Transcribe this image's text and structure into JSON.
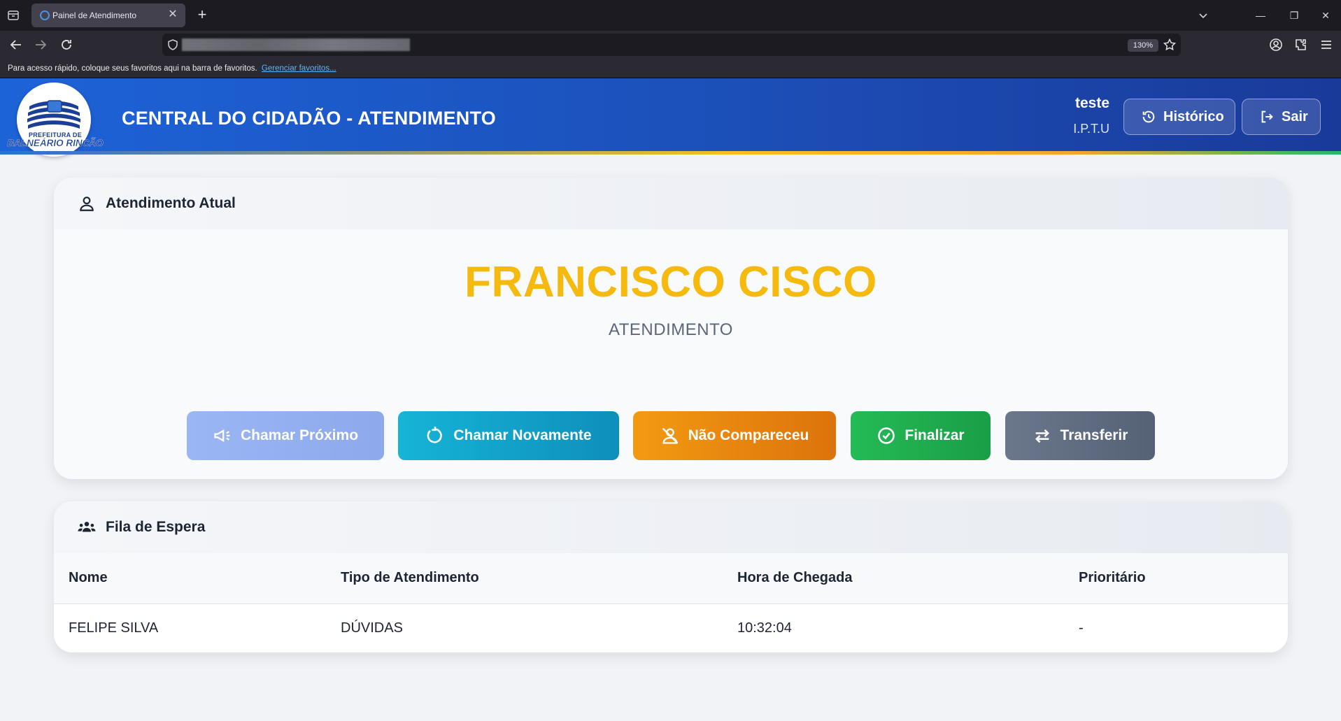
{
  "browser": {
    "tab_title": "Painel de Atendimento",
    "zoom": "130%",
    "bookmarks_text": "Para acesso rápido, coloque seus favoritos aqui na barra de favoritos.",
    "bookmarks_link": "Gerenciar favoritos..."
  },
  "header": {
    "logo_line1": "PREFEITURA DE",
    "logo_line2": "BALNEÁRIO RINCÃO",
    "title": "CENTRAL DO CIDADÃO - ATENDIMENTO",
    "user_name": "teste",
    "user_role": "I.P.T.U",
    "history_label": "Histórico",
    "logout_label": "Sair"
  },
  "current": {
    "title": "Atendimento Atual",
    "name": "FRANCISCO CISCO",
    "service": "ATENDIMENTO",
    "actions": {
      "call_next": "Chamar Próximo",
      "call_again": "Chamar Novamente",
      "no_show": "Não Compareceu",
      "finish": "Finalizar",
      "transfer": "Transferir"
    }
  },
  "queue": {
    "title": "Fila de Espera",
    "columns": [
      "Nome",
      "Tipo de Atendimento",
      "Hora de Chegada",
      "Prioritário"
    ],
    "rows": [
      [
        "FELIPE SILVA",
        "DÚVIDAS",
        "10:32:04",
        "-"
      ]
    ]
  },
  "colors": {
    "header_blue": "#1d63d8",
    "name_yellow": "#f6b90e",
    "call_next": "#97b0f2",
    "call_again": "#13a6c9",
    "no_show": "#ef8a12",
    "finish": "#21b04f",
    "transfer": "#5e6b80"
  }
}
